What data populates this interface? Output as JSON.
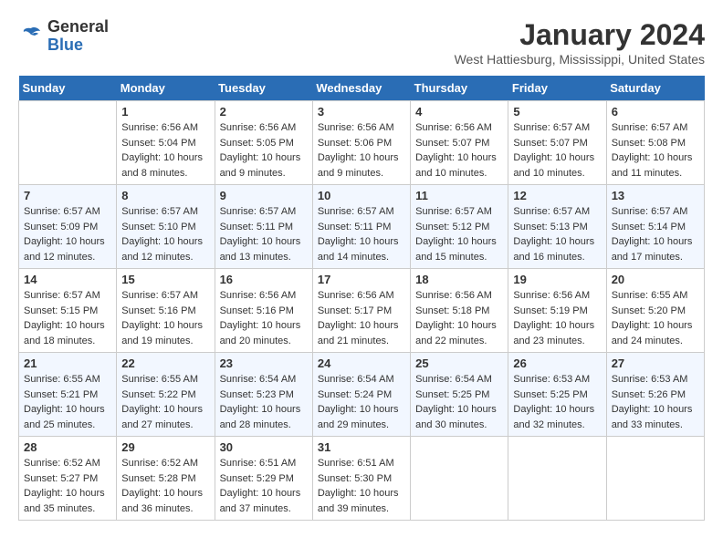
{
  "header": {
    "logo_text_general": "General",
    "logo_text_blue": "Blue",
    "month_title": "January 2024",
    "location": "West Hattiesburg, Mississippi, United States"
  },
  "weekdays": [
    "Sunday",
    "Monday",
    "Tuesday",
    "Wednesday",
    "Thursday",
    "Friday",
    "Saturday"
  ],
  "weeks": [
    [
      {
        "day": "",
        "sunrise": "",
        "sunset": "",
        "daylight": ""
      },
      {
        "day": "1",
        "sunrise": "Sunrise: 6:56 AM",
        "sunset": "Sunset: 5:04 PM",
        "daylight": "Daylight: 10 hours and 8 minutes."
      },
      {
        "day": "2",
        "sunrise": "Sunrise: 6:56 AM",
        "sunset": "Sunset: 5:05 PM",
        "daylight": "Daylight: 10 hours and 9 minutes."
      },
      {
        "day": "3",
        "sunrise": "Sunrise: 6:56 AM",
        "sunset": "Sunset: 5:06 PM",
        "daylight": "Daylight: 10 hours and 9 minutes."
      },
      {
        "day": "4",
        "sunrise": "Sunrise: 6:56 AM",
        "sunset": "Sunset: 5:07 PM",
        "daylight": "Daylight: 10 hours and 10 minutes."
      },
      {
        "day": "5",
        "sunrise": "Sunrise: 6:57 AM",
        "sunset": "Sunset: 5:07 PM",
        "daylight": "Daylight: 10 hours and 10 minutes."
      },
      {
        "day": "6",
        "sunrise": "Sunrise: 6:57 AM",
        "sunset": "Sunset: 5:08 PM",
        "daylight": "Daylight: 10 hours and 11 minutes."
      }
    ],
    [
      {
        "day": "7",
        "sunrise": "Sunrise: 6:57 AM",
        "sunset": "Sunset: 5:09 PM",
        "daylight": "Daylight: 10 hours and 12 minutes."
      },
      {
        "day": "8",
        "sunrise": "Sunrise: 6:57 AM",
        "sunset": "Sunset: 5:10 PM",
        "daylight": "Daylight: 10 hours and 12 minutes."
      },
      {
        "day": "9",
        "sunrise": "Sunrise: 6:57 AM",
        "sunset": "Sunset: 5:11 PM",
        "daylight": "Daylight: 10 hours and 13 minutes."
      },
      {
        "day": "10",
        "sunrise": "Sunrise: 6:57 AM",
        "sunset": "Sunset: 5:11 PM",
        "daylight": "Daylight: 10 hours and 14 minutes."
      },
      {
        "day": "11",
        "sunrise": "Sunrise: 6:57 AM",
        "sunset": "Sunset: 5:12 PM",
        "daylight": "Daylight: 10 hours and 15 minutes."
      },
      {
        "day": "12",
        "sunrise": "Sunrise: 6:57 AM",
        "sunset": "Sunset: 5:13 PM",
        "daylight": "Daylight: 10 hours and 16 minutes."
      },
      {
        "day": "13",
        "sunrise": "Sunrise: 6:57 AM",
        "sunset": "Sunset: 5:14 PM",
        "daylight": "Daylight: 10 hours and 17 minutes."
      }
    ],
    [
      {
        "day": "14",
        "sunrise": "Sunrise: 6:57 AM",
        "sunset": "Sunset: 5:15 PM",
        "daylight": "Daylight: 10 hours and 18 minutes."
      },
      {
        "day": "15",
        "sunrise": "Sunrise: 6:57 AM",
        "sunset": "Sunset: 5:16 PM",
        "daylight": "Daylight: 10 hours and 19 minutes."
      },
      {
        "day": "16",
        "sunrise": "Sunrise: 6:56 AM",
        "sunset": "Sunset: 5:16 PM",
        "daylight": "Daylight: 10 hours and 20 minutes."
      },
      {
        "day": "17",
        "sunrise": "Sunrise: 6:56 AM",
        "sunset": "Sunset: 5:17 PM",
        "daylight": "Daylight: 10 hours and 21 minutes."
      },
      {
        "day": "18",
        "sunrise": "Sunrise: 6:56 AM",
        "sunset": "Sunset: 5:18 PM",
        "daylight": "Daylight: 10 hours and 22 minutes."
      },
      {
        "day": "19",
        "sunrise": "Sunrise: 6:56 AM",
        "sunset": "Sunset: 5:19 PM",
        "daylight": "Daylight: 10 hours and 23 minutes."
      },
      {
        "day": "20",
        "sunrise": "Sunrise: 6:55 AM",
        "sunset": "Sunset: 5:20 PM",
        "daylight": "Daylight: 10 hours and 24 minutes."
      }
    ],
    [
      {
        "day": "21",
        "sunrise": "Sunrise: 6:55 AM",
        "sunset": "Sunset: 5:21 PM",
        "daylight": "Daylight: 10 hours and 25 minutes."
      },
      {
        "day": "22",
        "sunrise": "Sunrise: 6:55 AM",
        "sunset": "Sunset: 5:22 PM",
        "daylight": "Daylight: 10 hours and 27 minutes."
      },
      {
        "day": "23",
        "sunrise": "Sunrise: 6:54 AM",
        "sunset": "Sunset: 5:23 PM",
        "daylight": "Daylight: 10 hours and 28 minutes."
      },
      {
        "day": "24",
        "sunrise": "Sunrise: 6:54 AM",
        "sunset": "Sunset: 5:24 PM",
        "daylight": "Daylight: 10 hours and 29 minutes."
      },
      {
        "day": "25",
        "sunrise": "Sunrise: 6:54 AM",
        "sunset": "Sunset: 5:25 PM",
        "daylight": "Daylight: 10 hours and 30 minutes."
      },
      {
        "day": "26",
        "sunrise": "Sunrise: 6:53 AM",
        "sunset": "Sunset: 5:25 PM",
        "daylight": "Daylight: 10 hours and 32 minutes."
      },
      {
        "day": "27",
        "sunrise": "Sunrise: 6:53 AM",
        "sunset": "Sunset: 5:26 PM",
        "daylight": "Daylight: 10 hours and 33 minutes."
      }
    ],
    [
      {
        "day": "28",
        "sunrise": "Sunrise: 6:52 AM",
        "sunset": "Sunset: 5:27 PM",
        "daylight": "Daylight: 10 hours and 35 minutes."
      },
      {
        "day": "29",
        "sunrise": "Sunrise: 6:52 AM",
        "sunset": "Sunset: 5:28 PM",
        "daylight": "Daylight: 10 hours and 36 minutes."
      },
      {
        "day": "30",
        "sunrise": "Sunrise: 6:51 AM",
        "sunset": "Sunset: 5:29 PM",
        "daylight": "Daylight: 10 hours and 37 minutes."
      },
      {
        "day": "31",
        "sunrise": "Sunrise: 6:51 AM",
        "sunset": "Sunset: 5:30 PM",
        "daylight": "Daylight: 10 hours and 39 minutes."
      },
      {
        "day": "",
        "sunrise": "",
        "sunset": "",
        "daylight": ""
      },
      {
        "day": "",
        "sunrise": "",
        "sunset": "",
        "daylight": ""
      },
      {
        "day": "",
        "sunrise": "",
        "sunset": "",
        "daylight": ""
      }
    ]
  ]
}
